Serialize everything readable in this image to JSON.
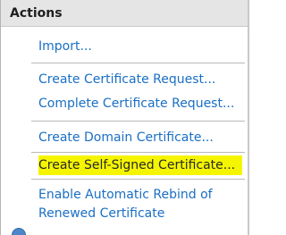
{
  "panel": {
    "title": "Actions",
    "items": [
      {
        "label": "Import..."
      },
      {
        "label": "Create Certificate Request..."
      },
      {
        "label": "Complete Certificate Request..."
      },
      {
        "label": "Create Domain Certificate..."
      },
      {
        "label": "Create Self-Signed Certificate..."
      },
      {
        "label_line1": "Enable Automatic Rebind of",
        "label_line2": "Renewed Certificate"
      }
    ]
  },
  "colors": {
    "link": "#1a6fc4",
    "header_bg": "#e5e5e5",
    "highlight": "#f5f500",
    "separator": "#b9b9b9"
  },
  "icons": {
    "bottom": "help-icon"
  }
}
